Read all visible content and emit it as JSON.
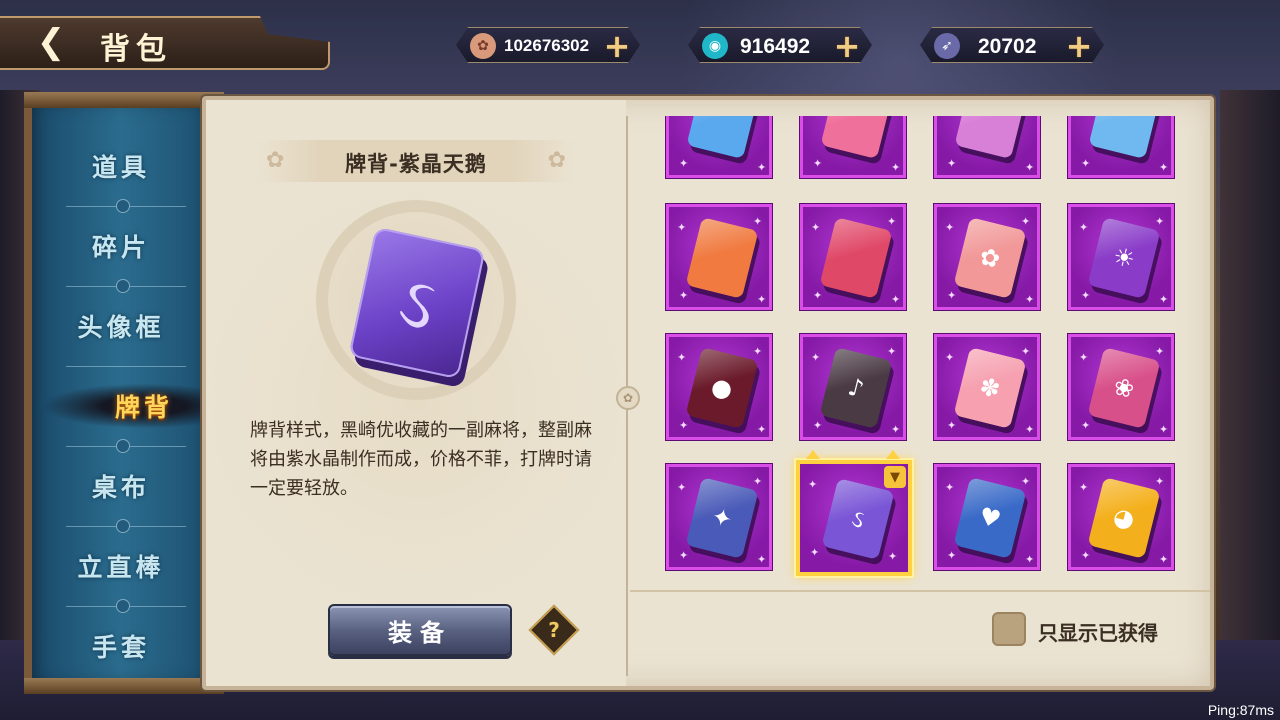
{
  "header": {
    "back_icon": "back-arrow-icon",
    "title": "背包"
  },
  "currencies": [
    {
      "name": "coin",
      "icon": "coin-icon",
      "value": "102676302"
    },
    {
      "name": "jade",
      "icon": "jade-icon",
      "value": "916492"
    },
    {
      "name": "fish",
      "icon": "fish-icon",
      "value": "20702"
    }
  ],
  "sidebar": {
    "items": [
      {
        "label": "道具",
        "active": false
      },
      {
        "label": "碎片",
        "active": false
      },
      {
        "label": "头像框",
        "active": false
      },
      {
        "label": "牌背",
        "active": true
      },
      {
        "label": "桌布",
        "active": false
      },
      {
        "label": "立直棒",
        "active": false
      },
      {
        "label": "手套",
        "active": false
      }
    ]
  },
  "detail": {
    "name": "牌背-紫晶天鹅",
    "description": "牌背样式，黑崎优收藏的一副麻将，整副麻将由紫水晶制作而成，价格不菲，打牌时请一定要轻放。",
    "equip_label": "装备",
    "help_label": "?"
  },
  "grid": {
    "cards": [
      {
        "design": "light-blue",
        "color": "#5aa8ee",
        "symbol": ""
      },
      {
        "design": "pink",
        "color": "#f0709c",
        "symbol": ""
      },
      {
        "design": "pink-violet",
        "color": "#d880d8",
        "symbol": ""
      },
      {
        "design": "sky-blue",
        "color": "#70b8f0",
        "symbol": ""
      },
      {
        "design": "orange",
        "color": "#f07a40",
        "symbol": ""
      },
      {
        "design": "crimson",
        "color": "#e04868",
        "symbol": ""
      },
      {
        "design": "flame",
        "color": "#f29898",
        "symbol": "✿"
      },
      {
        "design": "sun",
        "color": "#8a3cc8",
        "symbol": "☀"
      },
      {
        "design": "demon",
        "color": "#6a1a2a",
        "symbol": "●"
      },
      {
        "design": "ladle",
        "color": "#4a3a44",
        "symbol": "♪"
      },
      {
        "design": "paw",
        "color": "#f6a0b0",
        "symbol": "✽"
      },
      {
        "design": "rose",
        "color": "#d8508a",
        "symbol": "❀"
      },
      {
        "design": "knife",
        "color": "#4a5ab8",
        "symbol": "✦"
      },
      {
        "design": "swan",
        "color": "#7a56d6",
        "symbol": "ઽ",
        "selected": true,
        "equipped": true
      },
      {
        "design": "cocktail",
        "color": "#3a6ac8",
        "symbol": "♥"
      },
      {
        "design": "cat",
        "color": "#f4b01c",
        "symbol": "◕"
      }
    ]
  },
  "filter": {
    "label": "只显示已获得",
    "checked": false
  },
  "status": {
    "ping": "Ping:87ms"
  },
  "colors": {
    "panel_bg": "#ebe3d2",
    "nav_bg": "#2b6c8e",
    "active_nav": "#ffd55a",
    "cell_bg": "#9a24bc",
    "selected_border": "#ffd040"
  }
}
